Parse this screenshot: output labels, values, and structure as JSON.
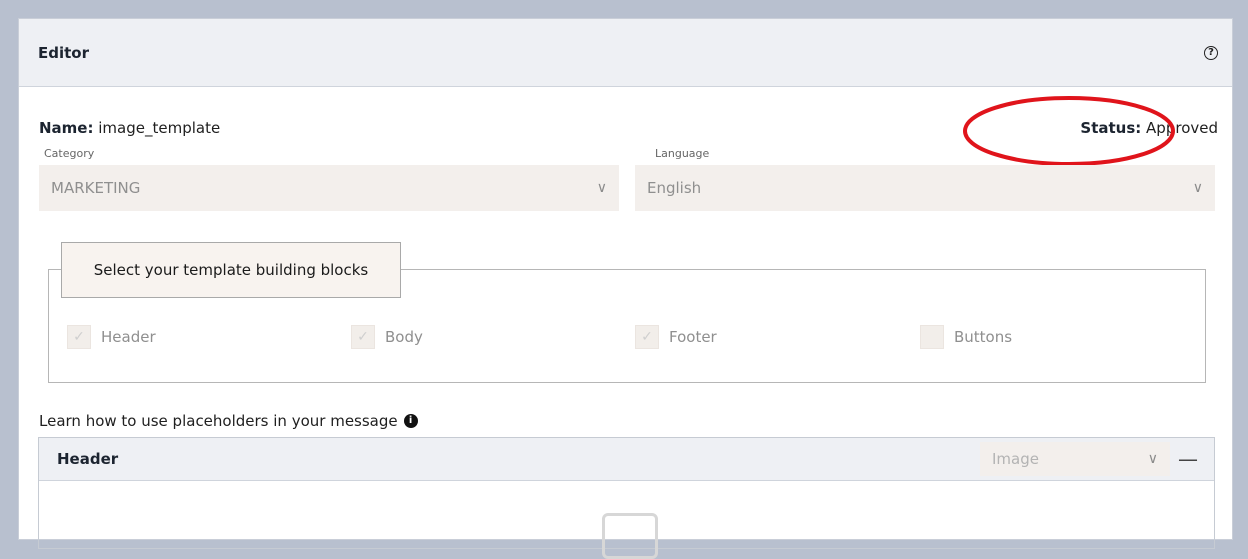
{
  "editor": {
    "title": "Editor",
    "help_icon": "help-circle-icon",
    "name_label": "Name:",
    "name_value": "image_template",
    "status_label": "Status:",
    "status_value": "Approved",
    "annotation_color": "#e0141b"
  },
  "category": {
    "label": "Category",
    "value": "MARKETING",
    "icon": "chevron-down-icon"
  },
  "language": {
    "label": "Language",
    "value": "English",
    "icon": "chevron-down-icon"
  },
  "blocks": {
    "title": "Select your template building blocks",
    "options": [
      {
        "label": "Header",
        "checked": true
      },
      {
        "label": "Body",
        "checked": true
      },
      {
        "label": "Footer",
        "checked": true
      },
      {
        "label": "Buttons",
        "checked": false
      }
    ]
  },
  "placeholders_link": {
    "text": "Learn how to use placeholders in your message",
    "icon": "info-icon"
  },
  "header_section": {
    "title": "Header",
    "type_value": "Image",
    "collapse_icon": "minus-icon",
    "placeholder_icon": "image-placeholder-icon"
  }
}
